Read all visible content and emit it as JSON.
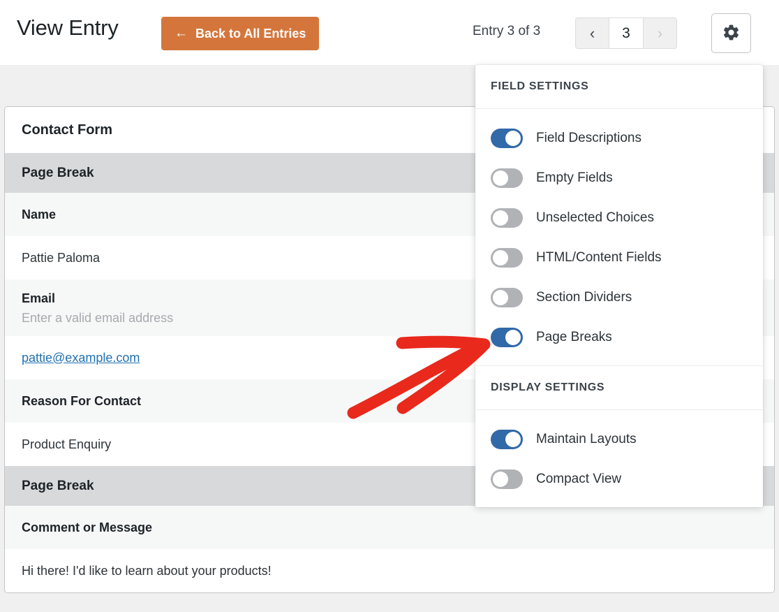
{
  "header": {
    "title": "View Entry",
    "back_button": {
      "label": "Back to All Entries",
      "icon": "arrow-left-icon"
    },
    "entry_counter": "Entry 3 of 3",
    "pager": {
      "prev_icon": "‹",
      "current_page": "3",
      "next_icon": "›"
    },
    "settings_icon": "gear-icon"
  },
  "entry_card": {
    "form_title": "Contact Form",
    "rows": [
      {
        "type": "pagebreak",
        "label": "Page Break"
      },
      {
        "type": "label",
        "label": "Name"
      },
      {
        "type": "value",
        "value": "Pattie Paloma"
      },
      {
        "type": "label",
        "label": "Email",
        "description": "Enter a valid email address"
      },
      {
        "type": "value",
        "value": "pattie@example.com",
        "link": true
      },
      {
        "type": "label",
        "label": "Reason For Contact"
      },
      {
        "type": "value",
        "value": "Product Enquiry"
      },
      {
        "type": "pagebreak",
        "label": "Page Break"
      },
      {
        "type": "label",
        "label": "Comment or Message"
      },
      {
        "type": "value",
        "value": "Hi there! I'd like to learn about your products!"
      }
    ]
  },
  "settings_panel": {
    "field_settings_title": "FIELD SETTINGS",
    "field_settings": [
      {
        "label": "Field Descriptions",
        "on": true
      },
      {
        "label": "Empty Fields",
        "on": false
      },
      {
        "label": "Unselected Choices",
        "on": false
      },
      {
        "label": "HTML/Content Fields",
        "on": false
      },
      {
        "label": "Section Dividers",
        "on": false
      },
      {
        "label": "Page Breaks",
        "on": true
      }
    ],
    "display_settings_title": "DISPLAY SETTINGS",
    "display_settings": [
      {
        "label": "Maintain Layouts",
        "on": true
      },
      {
        "label": "Compact View",
        "on": false
      }
    ]
  },
  "annotation": {
    "type": "arrow",
    "color": "#e8291c",
    "points_to": "Page Breaks toggle"
  },
  "colors": {
    "accent_orange": "#d4763c",
    "toggle_on_blue": "#3269a8",
    "toggle_off_gray": "#b0b2b5",
    "link_blue": "#2271b1",
    "annotation_red": "#e8291c",
    "page_background": "#f0f0f1",
    "pagebreak_row": "#d8d9db",
    "label_row": "#f6f7f7"
  }
}
